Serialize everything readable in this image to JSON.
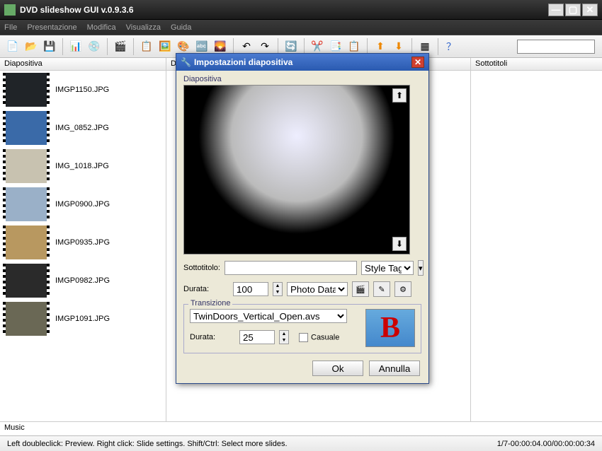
{
  "window": {
    "title": "DVD slideshow GUI v.0.9.3.6"
  },
  "menu": [
    "FIle",
    "Presentazione",
    "Modifica",
    "Visualizza",
    "Guida"
  ],
  "columns": {
    "slide": "Diapositiva",
    "duration": "Du",
    "subtitle": "Sottotitoli"
  },
  "slides": [
    {
      "name": "IMGP1150.JPG",
      "thumb": "#202428"
    },
    {
      "name": "IMG_0852.JPG",
      "thumb": "#3a6aa8"
    },
    {
      "name": "IMG_1018.JPG",
      "thumb": "#c8c2b0"
    },
    {
      "name": "IMGP0900.JPG",
      "thumb": "#9ab0c8"
    },
    {
      "name": "IMGP0935.JPG",
      "thumb": "#b89860"
    },
    {
      "name": "IMGP0982.JPG",
      "thumb": "#2a2a2a"
    },
    {
      "name": "IMGP1091.JPG",
      "thumb": "#6a6855"
    }
  ],
  "music_label": "Music",
  "status": {
    "left": "Left doubleclick: Preview. Right click: Slide settings. Shift/Ctrl: Select more slides.",
    "right": "1/7-00:00:04.00/00:00:00:34"
  },
  "dialog": {
    "title": "Impostazioni diapositiva",
    "section_slide": "Diapositiva",
    "subtitle_label": "Sottotitolo:",
    "subtitle_value": "",
    "styletags_label": "Style Tags",
    "duration_label": "Durata:",
    "duration_value": "100",
    "photo_data": "Photo Data",
    "section_transition": "Transizione",
    "transition_value": "TwinDoors_Vertical_Open.avs",
    "trans_duration_label": "Durata:",
    "trans_duration_value": "25",
    "random_label": "Casuale",
    "ok": "Ok",
    "cancel": "Annulla"
  }
}
